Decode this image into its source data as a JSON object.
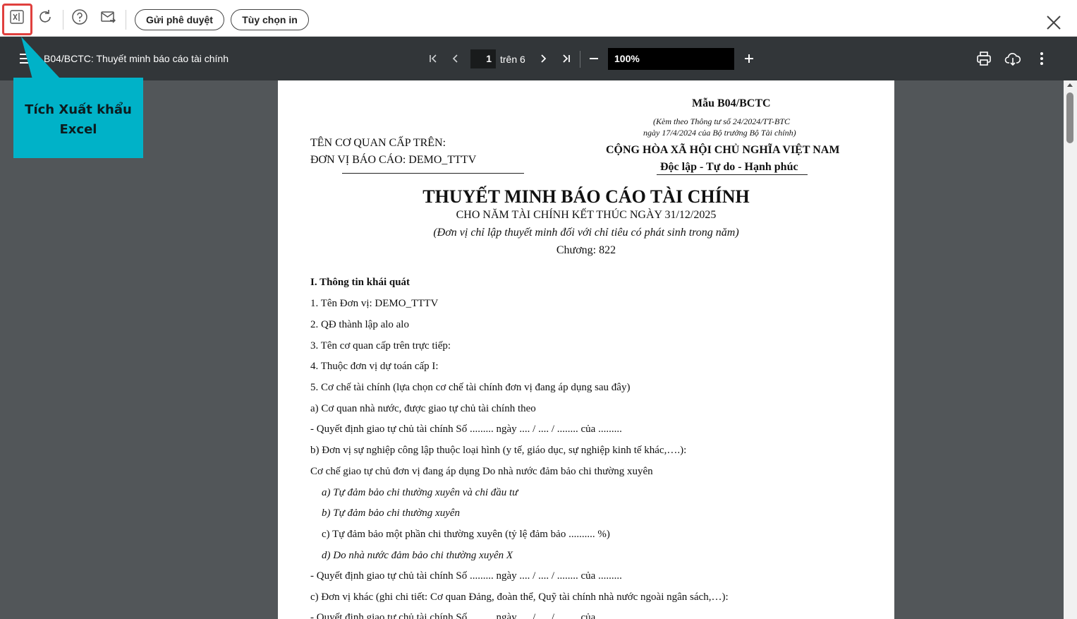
{
  "toolbar": {
    "icons": [
      "excel-export-icon",
      "refresh-icon",
      "help-icon",
      "mail-icon"
    ],
    "approve_label": "Gửi phê duyệt",
    "print_options_label": "Tùy chọn in"
  },
  "viewer": {
    "title": "B04/BCTC: Thuyết minh báo cáo tài chính",
    "current_page": "1",
    "page_of": "trên 6",
    "zoom": "100%"
  },
  "callout": {
    "line1": "Tích Xuất khẩu",
    "line2": "Excel",
    "color": "#00b2c8"
  },
  "document": {
    "form_code": "Mẫu B04/BCTC",
    "form_note1": "(Kèm theo Thông tư số 24/2024/TT-BTC",
    "form_note2": "ngày 17/4/2024 của Bộ trưởng Bộ Tài chính)",
    "agency": "TÊN CƠ QUAN CẤP TRÊN:",
    "unit": "ĐƠN VỊ BÁO CÁO: DEMO_TTTV",
    "nation": "CỘNG HÒA XÃ HỘI CHỦ NGHĨA VIỆT NAM",
    "motto": "Độc lập - Tự do - Hạnh phúc",
    "title": "THUYẾT MINH BÁO CÁO TÀI CHÍNH",
    "subtitle": "CHO NĂM TÀI CHÍNH KẾT THÚC NGÀY 31/12/2025",
    "note": "(Đơn vị chỉ lập thuyết minh đối với chỉ tiêu có phát sinh trong năm)",
    "chapter": "Chương: 822",
    "lines": [
      "I. Thông tin khái quát",
      "1. Tên Đơn vị: DEMO_TTTV",
      "2. QĐ thành lập alo alo",
      "3. Tên cơ quan cấp trên trực tiếp:",
      "4. Thuộc đơn vị dự toán cấp I:",
      "5. Cơ chế tài chính (lựa chọn cơ chế tài chính đơn vị đang áp dụng sau đây)",
      "a) Cơ quan nhà nước, được giao tự chủ tài chính theo",
      "- Quyết định giao tự chủ tài chính Số ......... ngày .... / .... / ........ của .........",
      "b) Đơn vị sự nghiệp công lập thuộc loại hình (y tế, giáo dục, sự nghiệp kinh tế khác,….):",
      "Cơ chế giao tự chủ đơn vị đang áp dụng Do nhà nước đảm bảo chi thường xuyên",
      "a) Tự đảm bảo chi thường xuyên và chi đầu tư",
      "b) Tự đảm bảo chi thường xuyên",
      "c) Tự đảm bảo một phần chi thường xuyên (tỷ lệ đảm bảo .......... %)",
      "d) Do nhà nước đảm bảo chi thường xuyên  X",
      "- Quyết định giao tự chủ tài chính Số ......... ngày .... / .... / ........ của .........",
      "c) Đơn vị khác (ghi chi tiết: Cơ quan Đảng, đoàn thể, Quỹ tài chính nhà nước ngoài ngân sách,…):",
      "- Quyết định giao tự chủ tài chính Số ......... ngày .... / .... / ........ của ........."
    ]
  }
}
